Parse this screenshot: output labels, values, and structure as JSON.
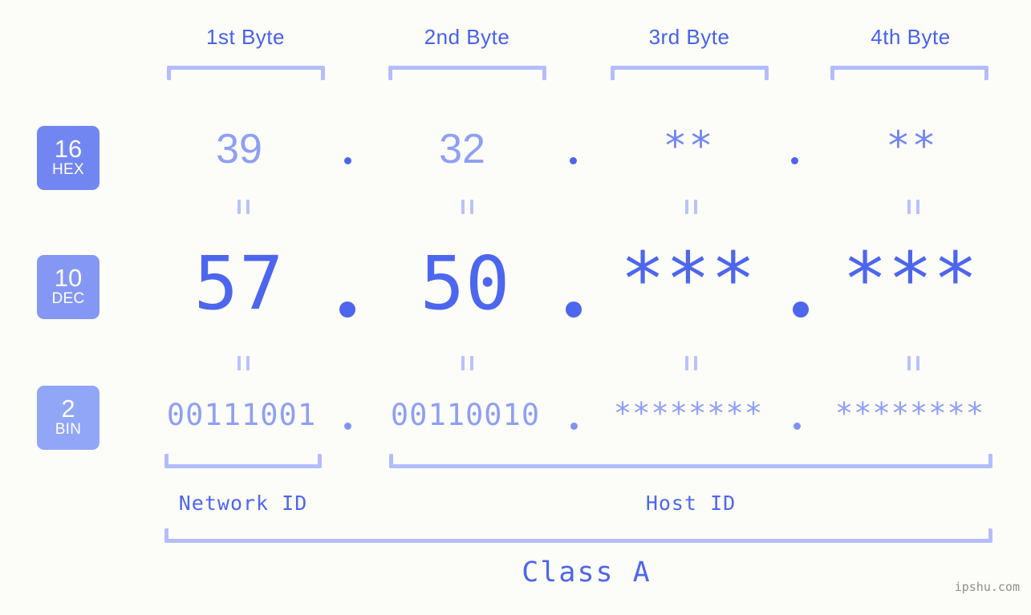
{
  "meta": {
    "background": "#fcfdf8",
    "accent_strong": "#4d66ee",
    "accent_mid": "#8e9ff5",
    "accent_light": "#b3bdfb",
    "watermark": "ipshu.com"
  },
  "byte_headers": [
    {
      "label": "1st Byte"
    },
    {
      "label": "2nd Byte"
    },
    {
      "label": "3rd Byte"
    },
    {
      "label": "4th Byte"
    }
  ],
  "bases": [
    {
      "number": "16",
      "name": "HEX",
      "color": "#7286f2"
    },
    {
      "number": "10",
      "name": "DEC",
      "color": "#8497f4"
    },
    {
      "number": "2",
      "name": "BIN",
      "color": "#91a6f7"
    }
  ],
  "rows": {
    "hex": {
      "base_number": "16",
      "base_name": "HEX",
      "values": [
        "39",
        "32",
        "**",
        "**"
      ],
      "separator": "."
    },
    "dec": {
      "base_number": "10",
      "base_name": "DEC",
      "values": [
        "57",
        "50",
        "***",
        "***"
      ],
      "separator": "."
    },
    "bin": {
      "base_number": "2",
      "base_name": "BIN",
      "values": [
        "00111001",
        "00110010",
        "********",
        "********"
      ],
      "separator": "."
    }
  },
  "equivalence_symbol": "=",
  "sections": {
    "network_id": "Network ID",
    "host_id": "Host ID",
    "class": "Class A"
  }
}
